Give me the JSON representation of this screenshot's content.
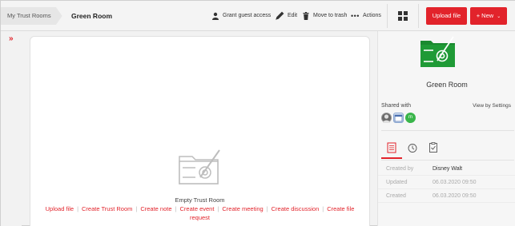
{
  "header": {
    "breadcrumb_root": "My Trust Rooms",
    "room_name": "Green Room",
    "grant_guest": "Grant guest access",
    "edit": "Edit",
    "move_to_trash": "Move to trash",
    "actions": "Actions",
    "upload_file": "Upload file",
    "new": "+ New"
  },
  "main": {
    "empty_title": "Empty Trust Room",
    "actions": [
      "Upload file",
      "Create Trust Room",
      "Create note",
      "Create event",
      "Create meeting",
      "Create discussion",
      "Create file request"
    ]
  },
  "side": {
    "title": "Green Room",
    "shared_with": "Shared with",
    "view_by_settings": "View by Settings",
    "avatar_initial": "m",
    "meta": [
      {
        "key": "Created by",
        "value": "Disney Walt"
      },
      {
        "key": "Updated",
        "value": "06.03.2020 09:50"
      },
      {
        "key": "Created",
        "value": "06.03.2020 09:50"
      }
    ]
  },
  "colors": {
    "accent": "#e2232b",
    "folder_green": "#1a8a2f"
  },
  "icons": [
    "expand-icon",
    "person-icon",
    "pencil-icon",
    "trash-icon",
    "more-icon",
    "grid-icon",
    "chevron-down-icon",
    "folder-safe-icon",
    "details-tab-icon",
    "history-tab-icon",
    "tasks-tab-icon"
  ]
}
